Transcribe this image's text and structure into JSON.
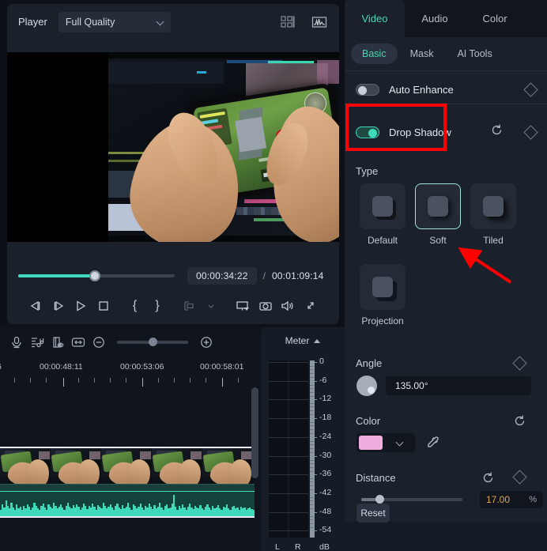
{
  "player": {
    "label": "Player",
    "quality_value": "Full Quality",
    "icons": [
      "grid-layout-icon",
      "scope-waveform-icon"
    ],
    "time_current": "00:00:34:22",
    "time_separator": "/",
    "time_total": "00:01:09:14",
    "seek_percent": 46,
    "transport": [
      {
        "name": "prev-frame-button",
        "label": "Previous Frame"
      },
      {
        "name": "next-frame-button",
        "label": "Next Frame"
      },
      {
        "name": "play-button",
        "label": "Play"
      },
      {
        "name": "stop-button",
        "label": "Stop"
      },
      {
        "name": "mark-in-button",
        "label": "{"
      },
      {
        "name": "mark-out-button",
        "label": "}"
      },
      {
        "name": "insert-button",
        "label": "Insert"
      },
      {
        "name": "insert-dropdown",
        "label": "More"
      },
      {
        "name": "display-settings-button",
        "label": "Display"
      },
      {
        "name": "snapshot-button",
        "label": "Snapshot"
      },
      {
        "name": "volume-button",
        "label": "Volume"
      },
      {
        "name": "fullscreen-button",
        "label": "Fullscreen"
      }
    ]
  },
  "timeline": {
    "toolbar_icons": [
      "microphone-icon",
      "audio-mixer-icon",
      "marker-eye-icon",
      "fit-to-screen-icon",
      "zoom-out-icon",
      "zoom-in-icon"
    ],
    "zoom_percent": 45,
    "ruler_labels": [
      "6",
      "00:00:48:11",
      "00:00:53:06",
      "00:00:58:01"
    ],
    "clip_name": ""
  },
  "meter": {
    "title": "Meter",
    "unit": "dB",
    "channels": [
      "L",
      "R"
    ],
    "scale": [
      "0",
      "-6",
      "-12",
      "-18",
      "-24",
      "-30",
      "-36",
      "-42",
      "-48",
      "-54"
    ]
  },
  "right_panel": {
    "tabs": [
      {
        "label": "Video",
        "active": true
      },
      {
        "label": "Audio",
        "active": false
      },
      {
        "label": "Color",
        "active": false
      }
    ],
    "subtabs": [
      {
        "label": "Basic",
        "active": true
      },
      {
        "label": "Mask",
        "active": false
      },
      {
        "label": "AI Tools",
        "active": false
      }
    ],
    "auto_enhance": {
      "label": "Auto Enhance",
      "enabled": false
    },
    "drop_shadow": {
      "label": "Drop Shadow",
      "enabled": true
    },
    "type": {
      "title": "Type",
      "options": [
        {
          "label": "Default",
          "selected": false
        },
        {
          "label": "Soft",
          "selected": true
        },
        {
          "label": "Tiled",
          "selected": false
        },
        {
          "label": "Projection",
          "selected": false
        }
      ]
    },
    "angle": {
      "label": "Angle",
      "value": "135.00°"
    },
    "color": {
      "label": "Color",
      "swatch": "#f0aede"
    },
    "distance": {
      "label": "Distance",
      "value": "17.00",
      "unit": "%",
      "percent": 17
    },
    "reset_label": "Reset"
  },
  "annotations": {
    "highlight_rect": "drop-shadow-row",
    "arrow_points_to": "Soft",
    "color": "#fe0000"
  }
}
